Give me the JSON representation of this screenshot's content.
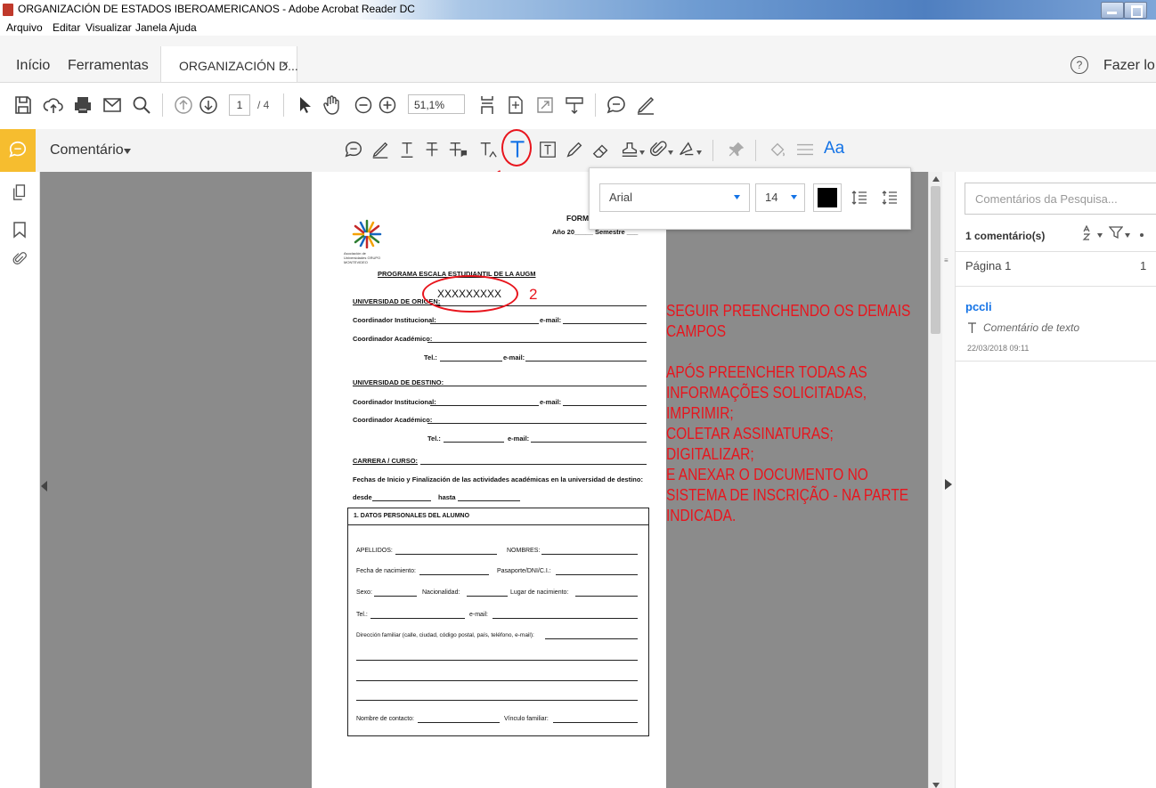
{
  "window": {
    "title": "ORGANIZACIÓN DE ESTADOS IBEROAMERICANOS - Adobe Acrobat Reader DC"
  },
  "menu": [
    "Arquivo",
    "Editar",
    "Visualizar",
    "Janela",
    "Ajuda"
  ],
  "tabs": {
    "home": "Início",
    "tools": "Ferramentas",
    "document": "ORGANIZACIÓN D...",
    "close": "×",
    "help": "?",
    "login": "Fazer lo"
  },
  "toolbar": {
    "page_current": "1",
    "page_total": "/ 4",
    "zoom": "51,1%"
  },
  "comment_bar": {
    "title": "Comentário",
    "text_tool_marker": "1",
    "aa": "Aa"
  },
  "font_popup": {
    "font": "Arial",
    "size": "14",
    "color": "#000000"
  },
  "right_panel": {
    "search_placeholder": "Comentários da Pesquisa...",
    "count": "1 comentário(s)",
    "page_label": "Página 1",
    "page_count": "1",
    "comment": {
      "author": "pccli",
      "type": "Comentário de texto",
      "date": "22/03/2018 09:11"
    }
  },
  "form": {
    "header1": "FORM-",
    "header2": "Año 20_____ Semestre ___",
    "logo_caption": "Asociación de Universidades GRUPO MONTEVIDEO",
    "program": "PROGRAMA ESCALA ESTUDIANTIL DE LA AUGM",
    "origin": "UNIVERSIDAD DE ORIGEN:",
    "added_text": "XXXXXXXXX",
    "marker2": "2",
    "coord_inst": "Coordinador Institucional:",
    "email": "e-mail:",
    "coord_acad": "Coordinador Académico:",
    "tel": "Tel.:",
    "destination": "UNIVERSIDAD DE DESTINO:",
    "career": "CARRERA / CURSO:",
    "dates": "Fechas de Inicio y Finalización de las actividades académicas en la universidad de destino:",
    "desde": "desde",
    "hasta": "hasta",
    "section1": "1. DATOS PERSONALES DEL ALUMNO",
    "apellidos": "APELLIDOS:",
    "nombres": "NOMBRES:",
    "nacimiento": "Fecha de nacimiento:",
    "pasaporte": "Pasaporte/DNI/C.I.:",
    "sexo": "Sexo:",
    "nacionalidad": "Nacionalidad:",
    "lugar": "Lugar de nacimiento:",
    "tel2": "Tel.:",
    "email2": "e-mail:",
    "direccion": "Dirección familiar (calle, ciudad, código postal, país, teléfono, e-mail):",
    "contacto": "Nombre de contacto:",
    "vinculo": "Vínculo familiar:"
  },
  "instructions": [
    "SEGUIR PREENCHENDO OS DEMAIS",
    "CAMPOS",
    "",
    "APÓS PREENCHER TODAS AS",
    "INFORMAÇÕES SOLICITADAS,",
    "IMPRIMIR;",
    "COLETAR ASSINATURAS;",
    "DIGITALIZAR;",
    "E ANEXAR O DOCUMENTO NO",
    "SISTEMA DE INSCRIÇÃO - NA PARTE",
    "INDICADA."
  ],
  "colors": {
    "accent_blue": "#1473e6",
    "annotation_red": "#e8151d",
    "comment_yellow": "#f6bd2f"
  }
}
